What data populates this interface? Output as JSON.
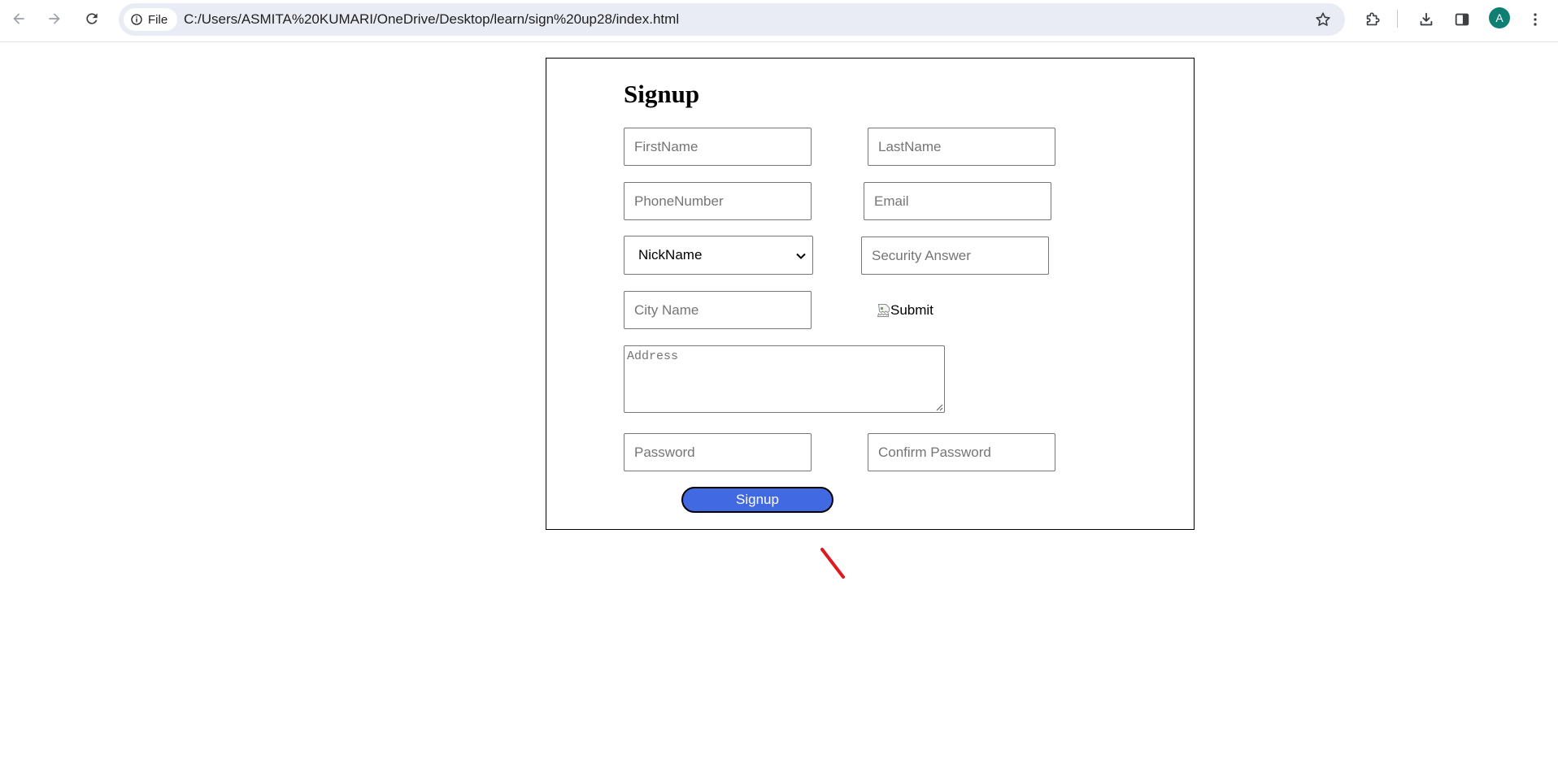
{
  "browser": {
    "site_chip_label": "File",
    "url": "C:/Users/ASMITA%20KUMARI/OneDrive/Desktop/learn/sign%20up28/index.html",
    "avatar_letter": "A",
    "icons": [
      "back-arrow-icon",
      "forward-arrow-icon",
      "reload-icon",
      "info-icon",
      "star-icon",
      "extensions-icon",
      "download-icon",
      "side-panel-icon",
      "more-vert-icon"
    ]
  },
  "form": {
    "title": "Signup",
    "first_name_placeholder": "FirstName",
    "last_name_placeholder": "LastName",
    "phone_placeholder": "PhoneNumber",
    "email_placeholder": "Email",
    "security_question_selected": "NickName",
    "security_answer_placeholder": "Security Answer",
    "city_placeholder": "City Name",
    "image_submit_alt": "Submit",
    "address_placeholder": "Address",
    "password_placeholder": "Password",
    "confirm_password_placeholder": "Confirm Password",
    "signup_button_label": "Signup"
  },
  "colors": {
    "signup_button": "#4169e1",
    "avatar_bg": "#0f7f74",
    "annotation_mark": "#e0191f",
    "omnibox_bg": "#e9ecf4"
  }
}
